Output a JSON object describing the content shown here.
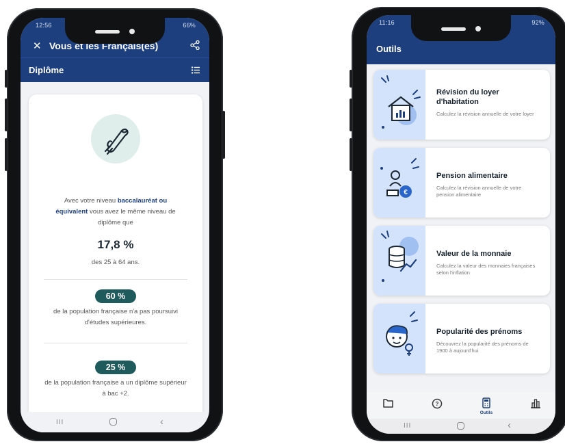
{
  "left_phone": {
    "status_time": "12:56",
    "status_right": "66%",
    "header": {
      "title": "Vous et les Français(es)"
    },
    "section": {
      "title": "Diplôme"
    },
    "card": {
      "lead_before": "Avec votre niveau ",
      "lead_highlight": "baccalauréat ou équivalent",
      "lead_after": " vous avez le même niveau de diplôme que",
      "main_percent": "17,8 %",
      "main_caption": "des 25 à 64 ans.",
      "stats": [
        {
          "percent": "60 %",
          "text": "de la population française n'a pas poursuivi d'études supérieures."
        },
        {
          "percent": "25 %",
          "text": "de la population française a un diplôme supérieur à bac +2."
        }
      ]
    }
  },
  "right_phone": {
    "status_time": "11:16",
    "status_right": "92%",
    "header": {
      "title": "Outils"
    },
    "tools": [
      {
        "title": "Révision du loyer d'habitation",
        "description": "Calculez la révision annuelle de votre loyer"
      },
      {
        "title": "Pension alimentaire",
        "description": "Calculez la révision annuelle de votre pension alimentaire"
      },
      {
        "title": "Valeur de la monnaie",
        "description": "Calculez la valeur des monnaies françaises selon l'inflation"
      },
      {
        "title": "Popularité des prénoms",
        "description": "Découvrez la popularité des prénoms de 1900 à aujourd'hui"
      }
    ],
    "tabs": [
      {
        "icon": "folder-icon",
        "label": ""
      },
      {
        "icon": "help-circle-icon",
        "label": ""
      },
      {
        "icon": "calculator-icon",
        "label": "Outils",
        "active": true
      },
      {
        "icon": "bar-chart-icon",
        "label": ""
      }
    ]
  },
  "system_nav": {
    "recent": "III",
    "home": "",
    "back": "‹"
  },
  "colors": {
    "primary": "#1d3f7d",
    "pill": "#1f5a5c",
    "illustration_bg": "#d3e3fb",
    "badge_bg": "#dfeeeb"
  }
}
